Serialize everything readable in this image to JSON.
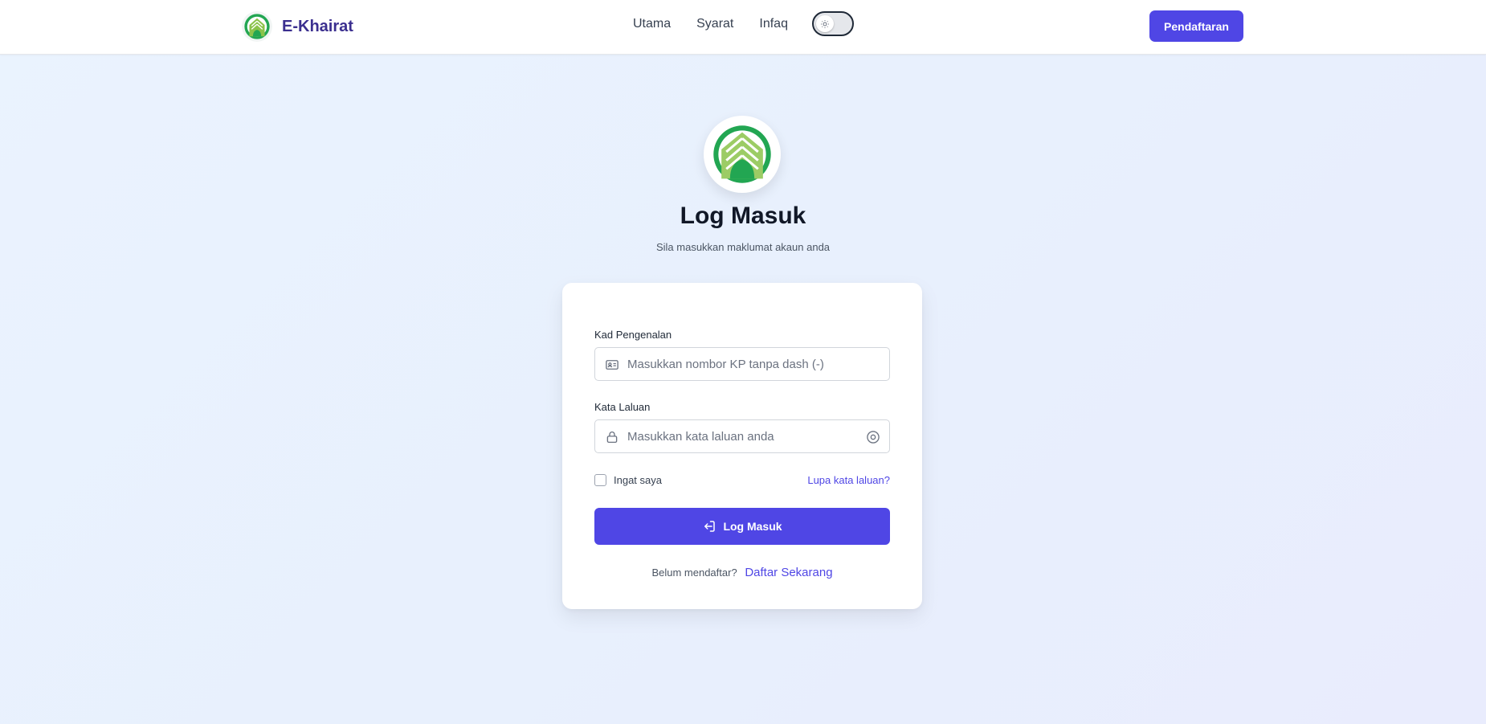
{
  "header": {
    "brand_name": "E-Khairat",
    "nav": [
      "Utama",
      "Syarat",
      "Infaq"
    ],
    "register_label": "Pendaftaran"
  },
  "login": {
    "title": "Log Masuk",
    "subtitle": "Sila masukkan maklumat akaun anda",
    "ic_label": "Kad Pengenalan",
    "ic_placeholder": "Masukkan nombor KP tanpa dash (-)",
    "password_label": "Kata Laluan",
    "password_placeholder": "Masukkan kata laluan anda",
    "remember_label": "Ingat saya",
    "forgot_label": "Lupa kata laluan?",
    "submit_label": "Log Masuk",
    "signup_prompt": "Belum mendaftar?",
    "signup_link": "Daftar Sekarang"
  },
  "colors": {
    "accent": "#4f46e5",
    "brand_text": "#3b2f8f",
    "logo_green": "#22a652"
  }
}
